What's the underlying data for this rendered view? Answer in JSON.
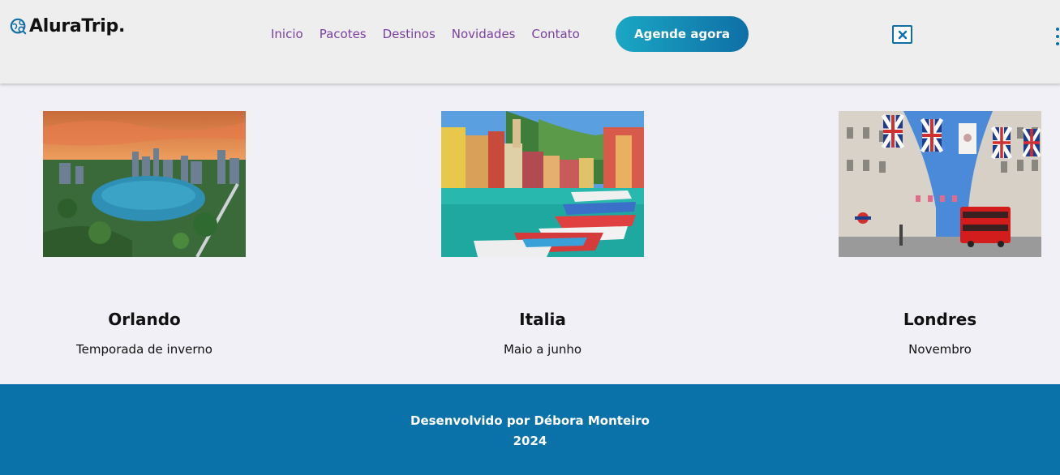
{
  "header": {
    "logo_text": "AluraTrip.",
    "nav": [
      "Inicio",
      "Pacotes",
      "Destinos",
      "Novidades",
      "Contato"
    ],
    "cta_label": "Agende agora"
  },
  "destinations": [
    {
      "title": "Orlando",
      "subtitle": "Temporada de inverno"
    },
    {
      "title": "Italia",
      "subtitle": "Maio a junho"
    },
    {
      "title": "Londres",
      "subtitle": "Novembro"
    }
  ],
  "footer": {
    "credit": "Desenvolvido por Débora Monteiro",
    "year": "2024"
  },
  "colors": {
    "accent": "#0f6fa6",
    "nav_link": "#7a3fa0",
    "footer_bg": "#0a72a8",
    "page_bg": "#f1f0f6"
  },
  "icons": [
    "globe-search-icon",
    "close-icon",
    "kebab-menu-icon"
  ]
}
